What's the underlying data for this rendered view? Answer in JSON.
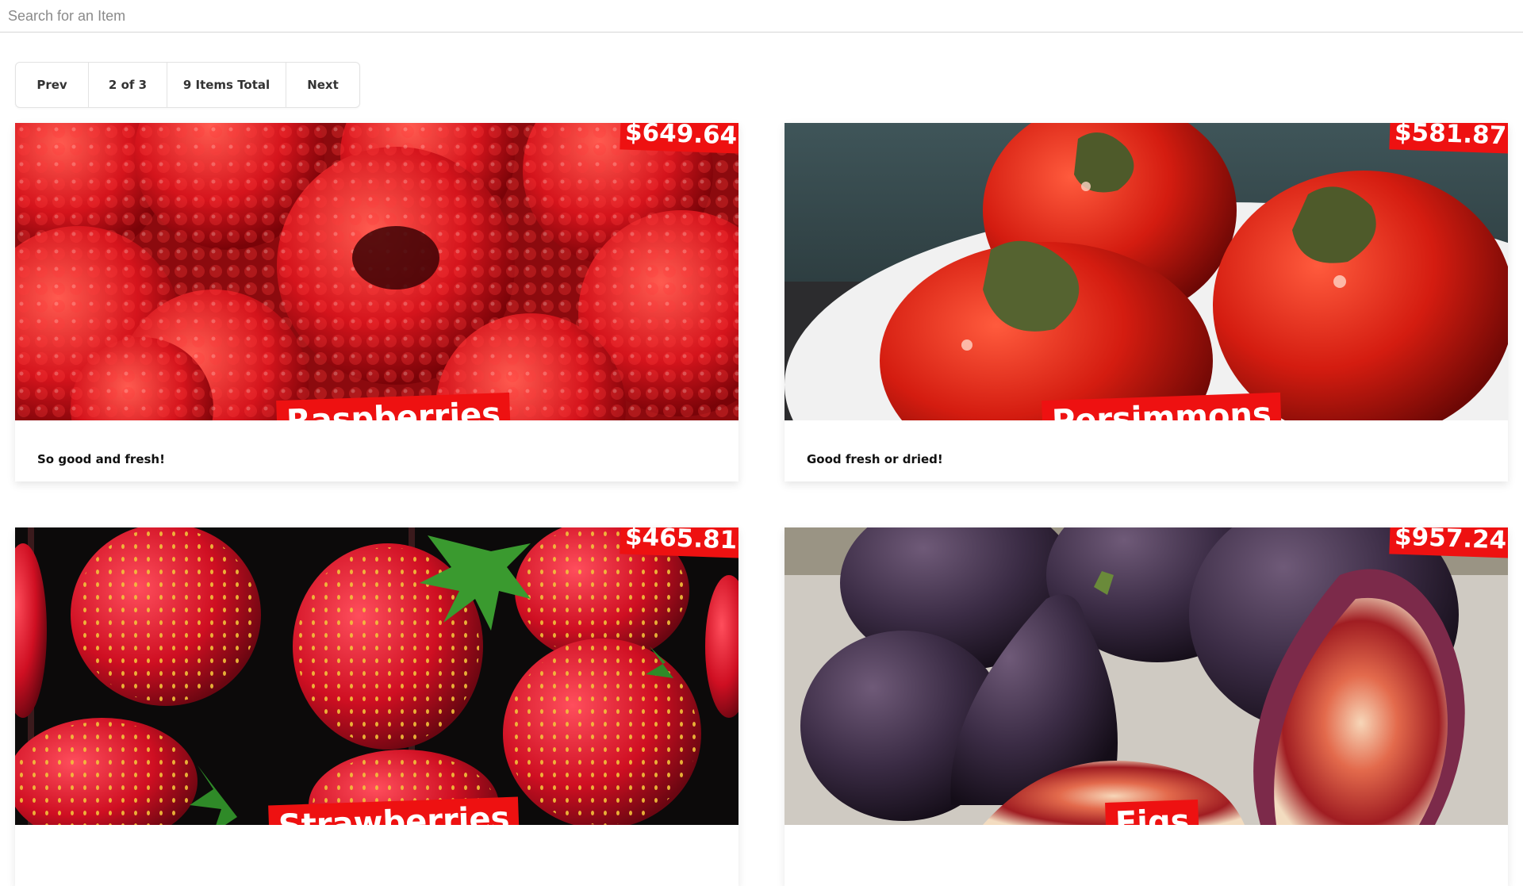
{
  "search": {
    "placeholder": "Search for an Item",
    "value": ""
  },
  "pagination": {
    "prev_label": "Prev",
    "page_label": "2 of 3",
    "total_label": "9 Items Total",
    "next_label": "Next"
  },
  "colors": {
    "tag_red": "#ee1111",
    "tag_text": "#ffffff",
    "border": "#e3e3e3"
  },
  "items": [
    {
      "name": "Raspberries",
      "price": "$649.64",
      "description": "So good and fresh!"
    },
    {
      "name": "Persimmons",
      "price": "$581.87",
      "description": "Good fresh or dried!"
    },
    {
      "name": "Strawberries",
      "price": "$465.81",
      "description": ""
    },
    {
      "name": "Figs",
      "price": "$957.24",
      "description": ""
    }
  ]
}
